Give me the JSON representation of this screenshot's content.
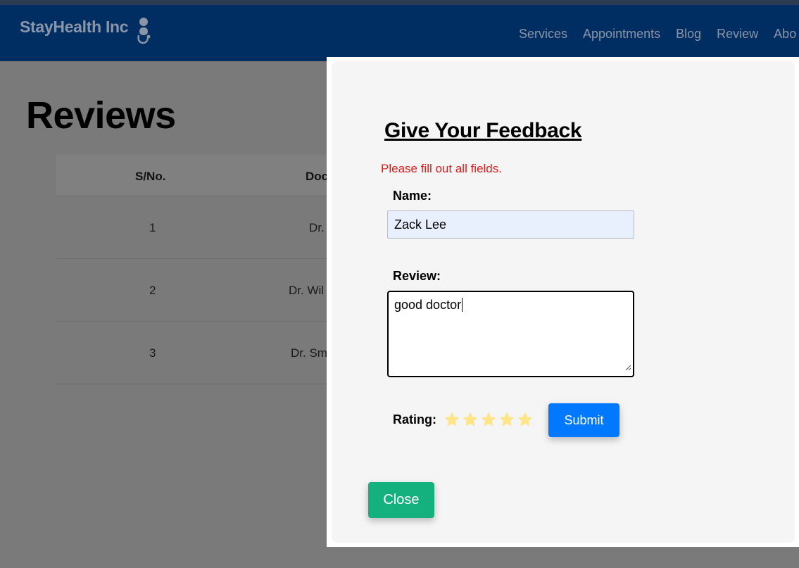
{
  "navbar": {
    "brand": "StayHealth Inc",
    "brand_icon": "doctor-stethoscope-icon",
    "links": [
      "Services",
      "Appointments",
      "Blog",
      "Review",
      "Abo"
    ]
  },
  "page": {
    "title": "Reviews",
    "table": {
      "headers": [
        "S/No.",
        "Doc"
      ],
      "rows": [
        {
          "sno": "1",
          "doctor": "Dr."
        },
        {
          "sno": "2",
          "doctor": "Dr. Wil"
        },
        {
          "sno": "3",
          "doctor": "Dr. Sm"
        }
      ]
    }
  },
  "modal": {
    "title": "Give Your Feedback",
    "error": "Please fill out all fields.",
    "name_label": "Name:",
    "name_value": "Zack Lee",
    "review_label": "Review:",
    "review_value": "good doctor",
    "rating_label": "Rating:",
    "rating_value": 0,
    "rating_max": 5,
    "star_color": "#fde68a",
    "submit_label": "Submit",
    "close_label": "Close"
  },
  "colors": {
    "navbar": "#002d62",
    "submit": "#0078ff",
    "close": "#14b17e",
    "error": "#dd1c1a"
  }
}
